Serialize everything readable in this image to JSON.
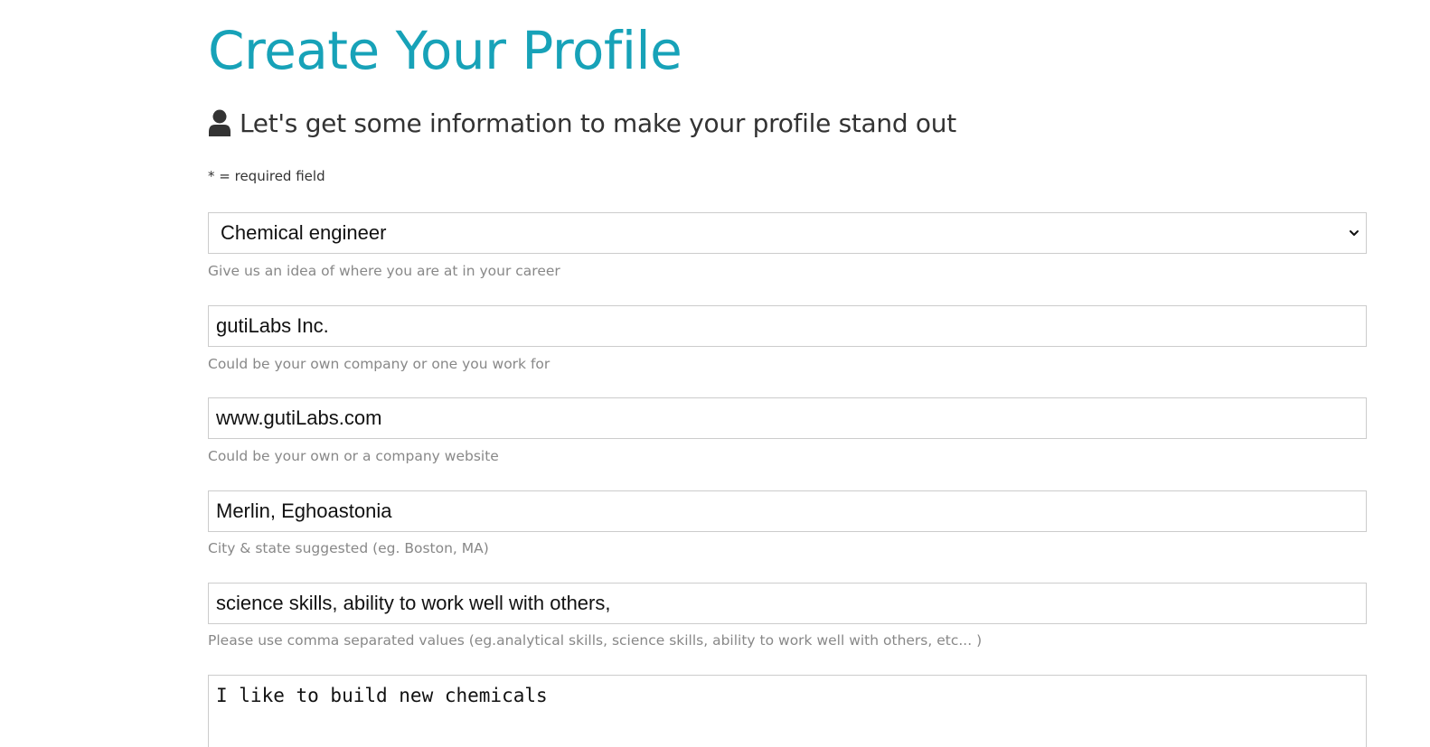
{
  "page": {
    "title": "Create Your Profile",
    "lead": "Let's get some information to make your profile stand out",
    "required_note": "* = required field"
  },
  "form": {
    "status": {
      "value": "Chemical engineer",
      "help": "Give us an idea of where you are at in your career"
    },
    "company": {
      "value": "gutiLabs Inc.",
      "help": "Could be your own company or one you work for"
    },
    "website": {
      "value": "www.gutiLabs.com",
      "help": "Could be your own or a company website"
    },
    "location": {
      "value": "Merlin, Eghoastonia",
      "help": "City & state suggested (eg. Boston, MA)"
    },
    "skills": {
      "value": "science skills, ability to work well with others,",
      "help": "Please use comma separated values (eg.analytical skills, science skills, ability to work well with others, etc... )"
    },
    "bio": {
      "value": "I like to build new chemicals"
    }
  },
  "icons": {
    "lead_icon": "user-icon",
    "select_icon": "chevron-down-icon"
  },
  "colors": {
    "accent": "#17a2b8",
    "text": "#333333",
    "muted": "#888888",
    "border": "#cccccc"
  }
}
